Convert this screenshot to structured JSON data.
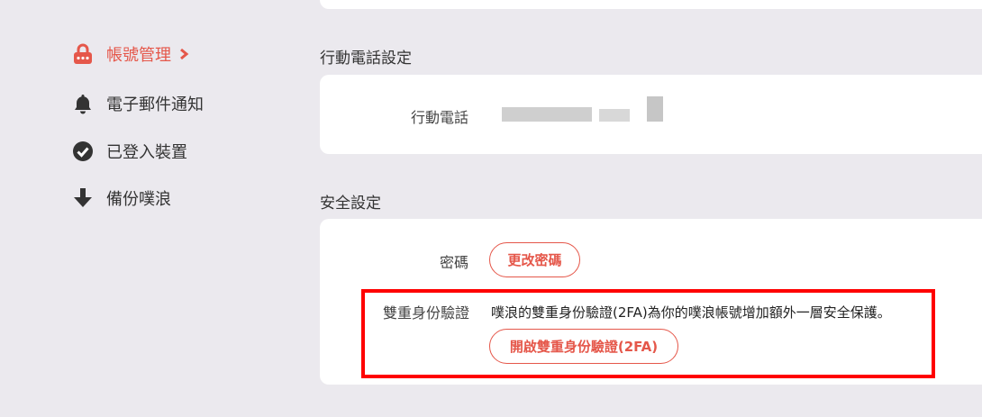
{
  "sidebar": {
    "items": [
      {
        "label": "帳號管理",
        "icon": "lock-icon",
        "active": true
      },
      {
        "label": "電子郵件通知",
        "icon": "bell-icon"
      },
      {
        "label": "已登入裝置",
        "icon": "check-circle-icon"
      },
      {
        "label": "備份噗浪",
        "icon": "arrow-down-icon"
      }
    ]
  },
  "phone_section": {
    "title": "行動電話設定",
    "phone_label": "行動電話",
    "phone_value_hidden": true
  },
  "security_section": {
    "title": "安全設定",
    "password_label": "密碼",
    "change_password_button": "更改密碼",
    "twofa_label": "雙重身份驗證",
    "twofa_description": "噗浪的雙重身份驗證(2FA)為你的噗浪帳號增加額外一層安全保護。",
    "enable_twofa_button": "開啟雙重身份驗證(2FA)"
  },
  "colors": {
    "accent": "#e5574a",
    "background": "#ebe9ee",
    "card": "#ffffff",
    "highlight_box": "#ff0000"
  }
}
